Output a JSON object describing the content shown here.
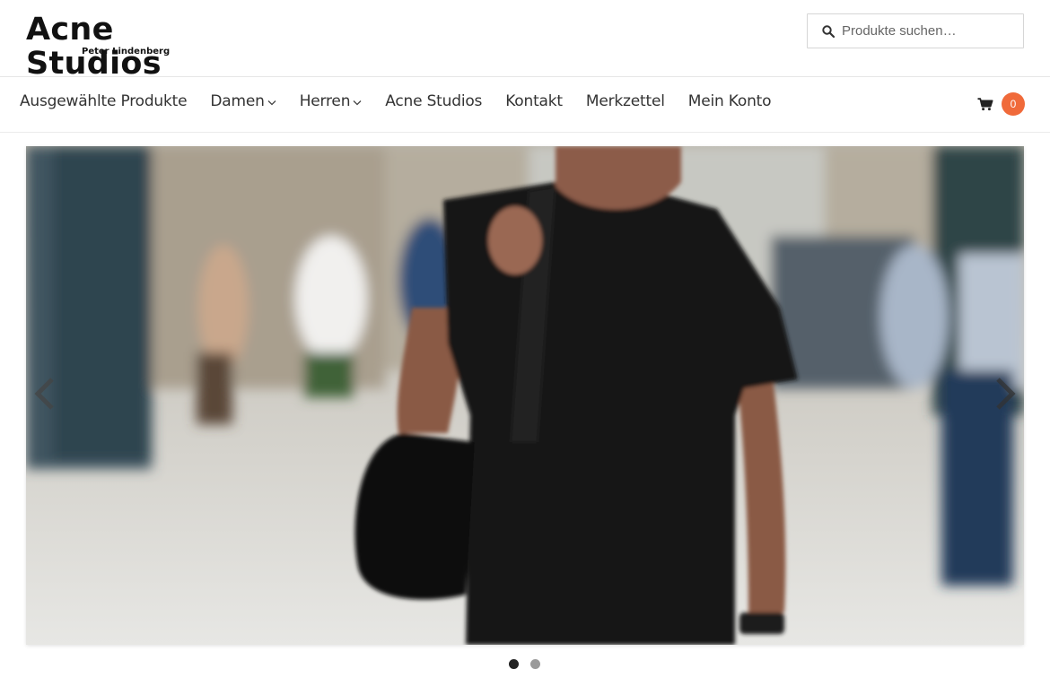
{
  "header": {
    "logo_title": "Acne Studios",
    "logo_subtitle": "Peter Lindenberg",
    "search_placeholder": "Produkte suchen…"
  },
  "nav": {
    "items": [
      {
        "label": "Ausgewählte Produkte",
        "has_dropdown": false
      },
      {
        "label": "Damen",
        "has_dropdown": true
      },
      {
        "label": "Herren",
        "has_dropdown": true
      },
      {
        "label": "Acne Studios",
        "has_dropdown": false
      },
      {
        "label": "Kontakt",
        "has_dropdown": false
      },
      {
        "label": "Merkzettel",
        "has_dropdown": false
      },
      {
        "label": "Mein Konto",
        "has_dropdown": false
      }
    ],
    "cart_count": "0",
    "cart_icon": "shopping-cart-icon"
  },
  "slider": {
    "image_description_icon": "hero-photo",
    "prev_icon": "chevron-left-icon",
    "next_icon": "chevron-right-icon",
    "slide_count": 2,
    "active_slide": 1
  },
  "colors": {
    "accent": "#f06a3a",
    "text": "#333333",
    "dot_active": "#222222",
    "dot_inactive": "#9a9a9a"
  }
}
